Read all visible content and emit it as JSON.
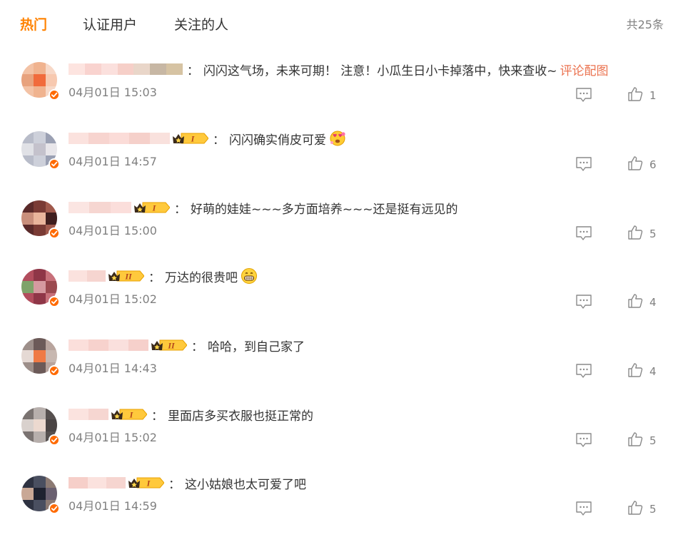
{
  "tabs": [
    {
      "label": "热门",
      "active": true
    },
    {
      "label": "认证用户",
      "active": false
    },
    {
      "label": "关注的人",
      "active": false
    }
  ],
  "total": "共25条",
  "colors": {
    "accent": "#ff8200",
    "link": "#eb7350",
    "muted": "#808080",
    "text": "#333333"
  },
  "comments": [
    {
      "separator": "：",
      "text": "闪闪这气场，未来可期！ 注意！小瓜生日小卡掉落中，快来查收~",
      "link": "评论配图",
      "time": "04月01日 15:03",
      "likes": "1",
      "vip_level": "",
      "verified": true
    },
    {
      "separator": "：",
      "text": "闪闪确实俏皮可爱",
      "emoji": "heart-eyes-emoji",
      "time": "04月01日 14:57",
      "likes": "6",
      "vip_level": "I",
      "verified": true
    },
    {
      "separator": "：",
      "text": "好萌的娃娃~~~多方面培养~~~还是挺有远见的",
      "time": "04月01日 15:00",
      "likes": "5",
      "vip_level": "I",
      "verified": true
    },
    {
      "separator": "：",
      "text": "万达的很贵吧",
      "emoji": "grin-emoji",
      "time": "04月01日 15:02",
      "likes": "4",
      "vip_level": "II",
      "verified": true
    },
    {
      "separator": "：",
      "text": "哈哈，到自己家了",
      "time": "04月01日 14:43",
      "likes": "4",
      "vip_level": "II",
      "verified": true
    },
    {
      "separator": "：",
      "text": "里面店多买衣服也挺正常的",
      "time": "04月01日 15:02",
      "likes": "5",
      "vip_level": "I",
      "verified": true
    },
    {
      "separator": "：",
      "text": "这小姑娘也太可爱了吧",
      "time": "04月01日 14:59",
      "likes": "5",
      "vip_level": "I",
      "verified": true
    }
  ]
}
